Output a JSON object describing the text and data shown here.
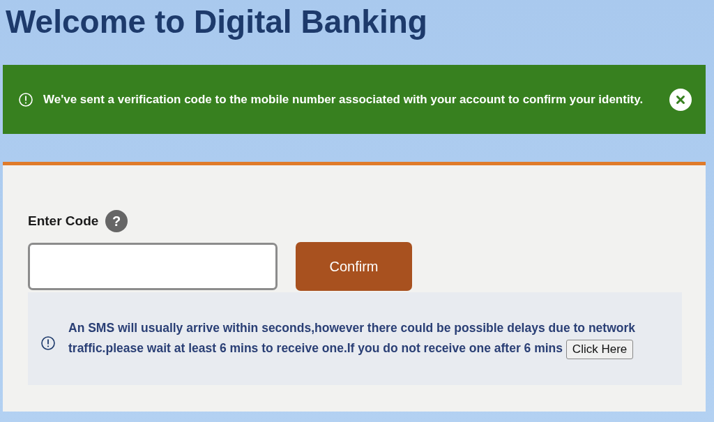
{
  "page": {
    "title": "Welcome to Digital Banking"
  },
  "alert": {
    "message": "We've sent a verification code to the mobile number associated with your account to confirm your identity.",
    "dismissible": true
  },
  "form": {
    "label": "Enter Code",
    "help_icon": "?",
    "confirm_button": "Confirm"
  },
  "notice": {
    "message": "An SMS will usually arrive within seconds,however there could be possible delays due to network traffic.please wait at least 6 mins to receive one.If you do not receive one after 6 mins",
    "link_button": "Click Here"
  }
}
